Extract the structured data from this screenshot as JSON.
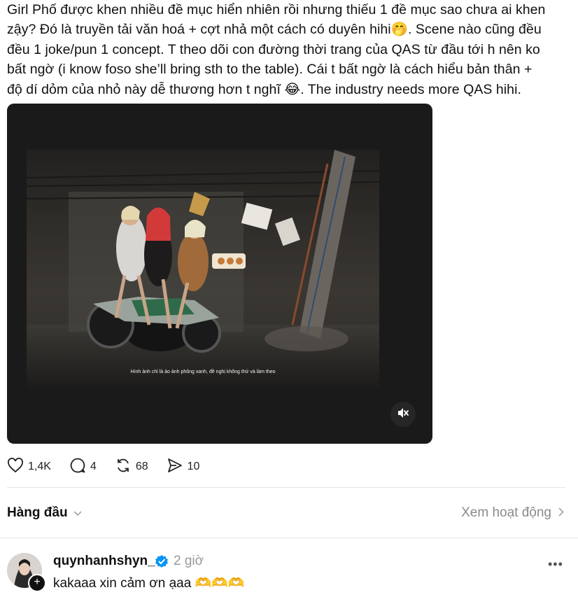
{
  "post": {
    "text": "Girl Phố được khen nhiều đề mục hiển nhiên rồi nhưng thiếu 1 đề mục sao chưa ai khen\nzậy? Đó là truyền tải văn hoá + cợt nhả một cách có duyên hihi🤭. Scene nào cũng đều\nđều 1 joke/pun 1 concept. T theo dõi con đường thời trang của QAS từ đầu tới h nên ko\nbất ngờ (i know foso she’ll bring sth to the table). Cái t bất ngờ là cách hiểu bản thân +\nđộ dí dỏm của nhỏ này dễ thương hơn t nghĩ 😂. The industry needs more QAS hihi."
  },
  "video": {
    "subtitle": "Hình ảnh chỉ là ảo ảnh phông xanh, đề nghị không thử và làm theo",
    "mute_icon": "speaker-muted-icon"
  },
  "actions": {
    "likes": "1,4K",
    "comments": "4",
    "reposts": "68",
    "shares": "10"
  },
  "replies_header": {
    "sort_label": "Hàng đầu",
    "activity_label": "Xem hoạt động"
  },
  "reply": {
    "username": "quynhanhshyn_",
    "time": "2 giờ",
    "text": "kakaaa xin cảm ơn ạaa 🫶🫶🫶"
  },
  "colors": {
    "accent_verified": "#0095f6",
    "muted_text": "#999999"
  }
}
